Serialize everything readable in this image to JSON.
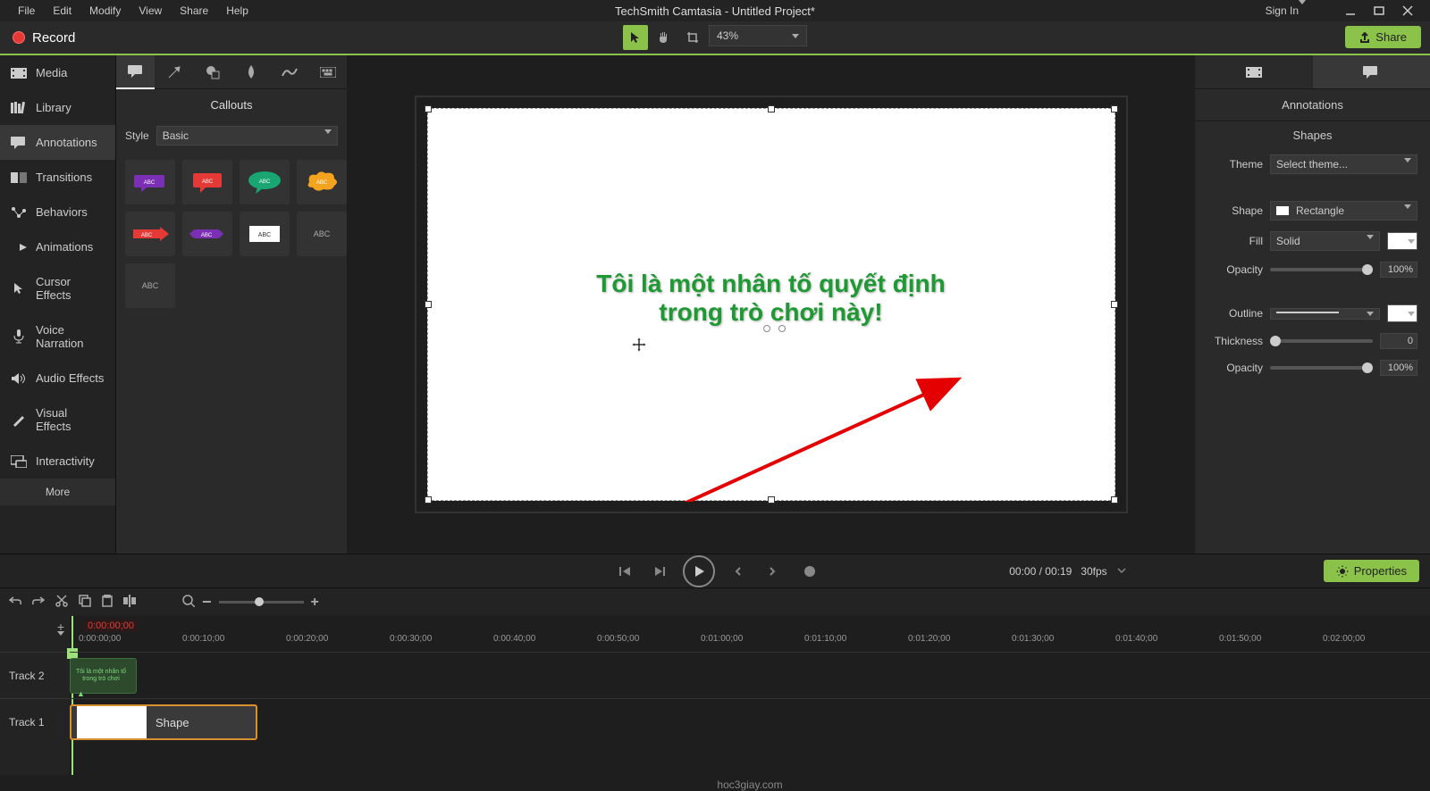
{
  "menubar": {
    "items": [
      "File",
      "Edit",
      "Modify",
      "View",
      "Share",
      "Help"
    ],
    "title": "TechSmith Camtasia - Untitled Project*",
    "signin": "Sign In"
  },
  "toolbar": {
    "record": "Record",
    "zoom": "43%",
    "share": "Share"
  },
  "sidebar": {
    "items": [
      "Media",
      "Library",
      "Annotations",
      "Transitions",
      "Behaviors",
      "Animations",
      "Cursor Effects",
      "Voice Narration",
      "Audio Effects",
      "Visual Effects",
      "Interactivity"
    ],
    "more": "More"
  },
  "gallery": {
    "title": "Callouts",
    "styleLabel": "Style",
    "styleValue": "Basic"
  },
  "canvas": {
    "line1": "Tôi là một nhân tố quyết định",
    "line2": "trong trò chơi này!"
  },
  "properties": {
    "title": "Annotations",
    "shapes": "Shapes",
    "themeLabel": "Theme",
    "themeValue": "Select theme...",
    "shapeLabel": "Shape",
    "shapeValue": "Rectangle",
    "fillLabel": "Fill",
    "fillValue": "Solid",
    "opacityLabel": "Opacity",
    "opacityValue": "100%",
    "outlineLabel": "Outline",
    "thicknessLabel": "Thickness",
    "thicknessValue": "0",
    "opacity2Label": "Opacity",
    "opacity2Value": "100%"
  },
  "playback": {
    "time": "00:00 / 00:19",
    "fps": "30fps",
    "propertiesBtn": "Properties"
  },
  "timeline": {
    "timecode": "0:00:00;00",
    "marks": [
      "0:00:00;00",
      "0:00:10;00",
      "0:00:20;00",
      "0:00:30;00",
      "0:00:40;00",
      "0:00:50;00",
      "0:01:00;00",
      "0:01:10;00",
      "0:01:20;00",
      "0:01:30;00",
      "0:01:40;00",
      "0:01:50;00",
      "0:02:00;00"
    ],
    "track2": "Track 2",
    "track1": "Track 1",
    "shapeClip": "Shape"
  },
  "watermark": "hoc3giay.com"
}
